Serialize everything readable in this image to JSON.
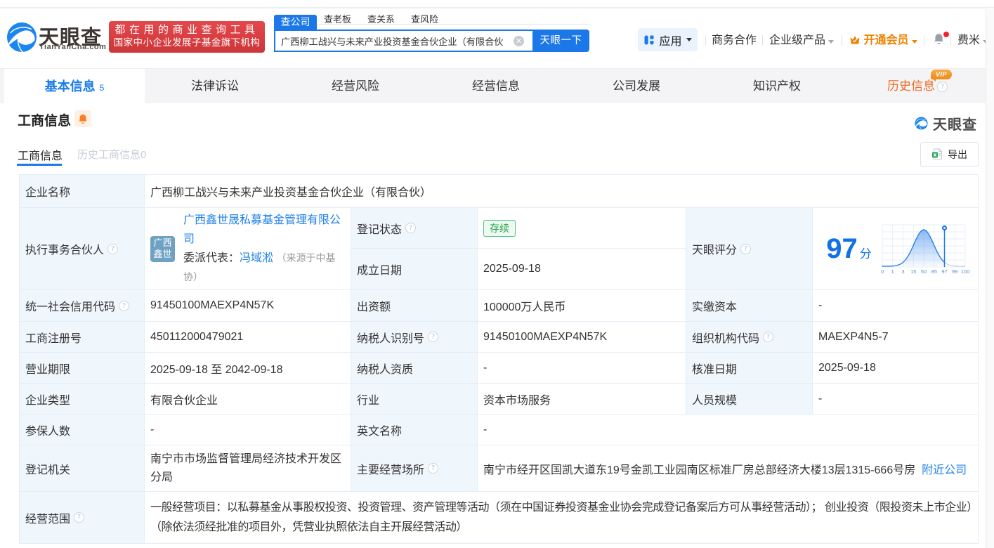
{
  "brand": {
    "name": "天眼查",
    "domain": "TianYanCha.com",
    "slogan_line1": "都在用的商业查询工具",
    "slogan_line2": "国家中小企业发展子基金旗下机构"
  },
  "search": {
    "tabs": [
      {
        "label": "查公司"
      },
      {
        "label": "查老板"
      },
      {
        "label": "查关系"
      },
      {
        "label": "查风险"
      }
    ],
    "query": "广西柳工战兴与未来产业投资基金合伙企业（有限合伙",
    "button": "天眼一下"
  },
  "top_nav": {
    "apps": "应用",
    "biz_coop": "商务合作",
    "enterprise": "企业级产品",
    "vip": "开通会员",
    "user": "费米"
  },
  "main_tabs": [
    {
      "label": "基本信息",
      "count": "5"
    },
    {
      "label": "法律诉讼"
    },
    {
      "label": "经营风险"
    },
    {
      "label": "经营信息"
    },
    {
      "label": "公司发展"
    },
    {
      "label": "知识产权"
    },
    {
      "label": "历史信息",
      "vip": "VIP"
    }
  ],
  "section": {
    "title": "工商信息",
    "subtab_active": "工商信息",
    "subtab_history": "历史工商信息0",
    "export_label": "导出",
    "watermark": "天眼查"
  },
  "table": {
    "company_name_label": "企业名称",
    "company_name": "广西柳工战兴与未来产业投资基金合伙企业（有限合伙）",
    "partner_label": "执行事务合伙人",
    "partner_company": "广西鑫世晟私募基金管理有限公司",
    "partner_avatar_line1": "广西",
    "partner_avatar_line2": "鑫世",
    "partner_rep_prefix": "委派代表：",
    "partner_rep_name": "冯域淞",
    "partner_rep_source": "（来源于中基协）",
    "reg_status_label": "登记状态",
    "reg_status": "存续",
    "est_date_label": "成立日期",
    "est_date": "2025-09-18",
    "score_label": "天眼评分",
    "score": "97",
    "score_unit": "分",
    "credit_code_label": "统一社会信用代码",
    "credit_code": "91450100MAEXP4N57K",
    "capital_label": "出资额",
    "capital": "100000万人民币",
    "paid_capital_label": "实缴资本",
    "paid_capital": "-",
    "reg_no_label": "工商注册号",
    "reg_no": "450112000479021",
    "tax_id_label": "纳税人识别号",
    "tax_id": "91450100MAEXP4N57K",
    "org_code_label": "组织机构代码",
    "org_code": "MAEXP4N5-7",
    "biz_term_label": "营业期限",
    "biz_term": "2025-09-18 至 2042-09-18",
    "tax_quality_label": "纳税人资质",
    "tax_quality": "-",
    "approve_date_label": "核准日期",
    "approve_date": "2025-09-18",
    "company_type_label": "企业类型",
    "company_type": "有限合伙企业",
    "industry_label": "行业",
    "industry": "资本市场服务",
    "staff_size_label": "人员规模",
    "staff_size": "-",
    "insured_label": "参保人数",
    "insured": "-",
    "english_name_label": "英文名称",
    "english_name": "-",
    "reg_authority_label": "登记机关",
    "reg_authority": "南宁市市场监督管理局经济技术开发区分局",
    "address_label": "主要经营场所",
    "address": "南宁市经开区国凯大道东19号金凯工业园南区标准厂房总部经济大楼13层1315-666号房",
    "nearby_link": "附近公司",
    "biz_scope_label": "经营范围",
    "biz_scope": "一般经营项目：以私募基金从事股权投资、投资管理、资产管理等活动（须在中国证券投资基金业协会完成登记备案后方可从事经营活动）； 创业投资（限投资未上市企业）（除依法须经批准的项目外，凭营业执照依法自主开展经营活动）"
  },
  "score_chart": {
    "type": "area",
    "ticks": [
      "0",
      "1",
      "3",
      "15",
      "50",
      "85",
      "97",
      "99",
      "100"
    ],
    "value": 97,
    "marker_tick": "97",
    "curve_color": "#2c80ea"
  }
}
